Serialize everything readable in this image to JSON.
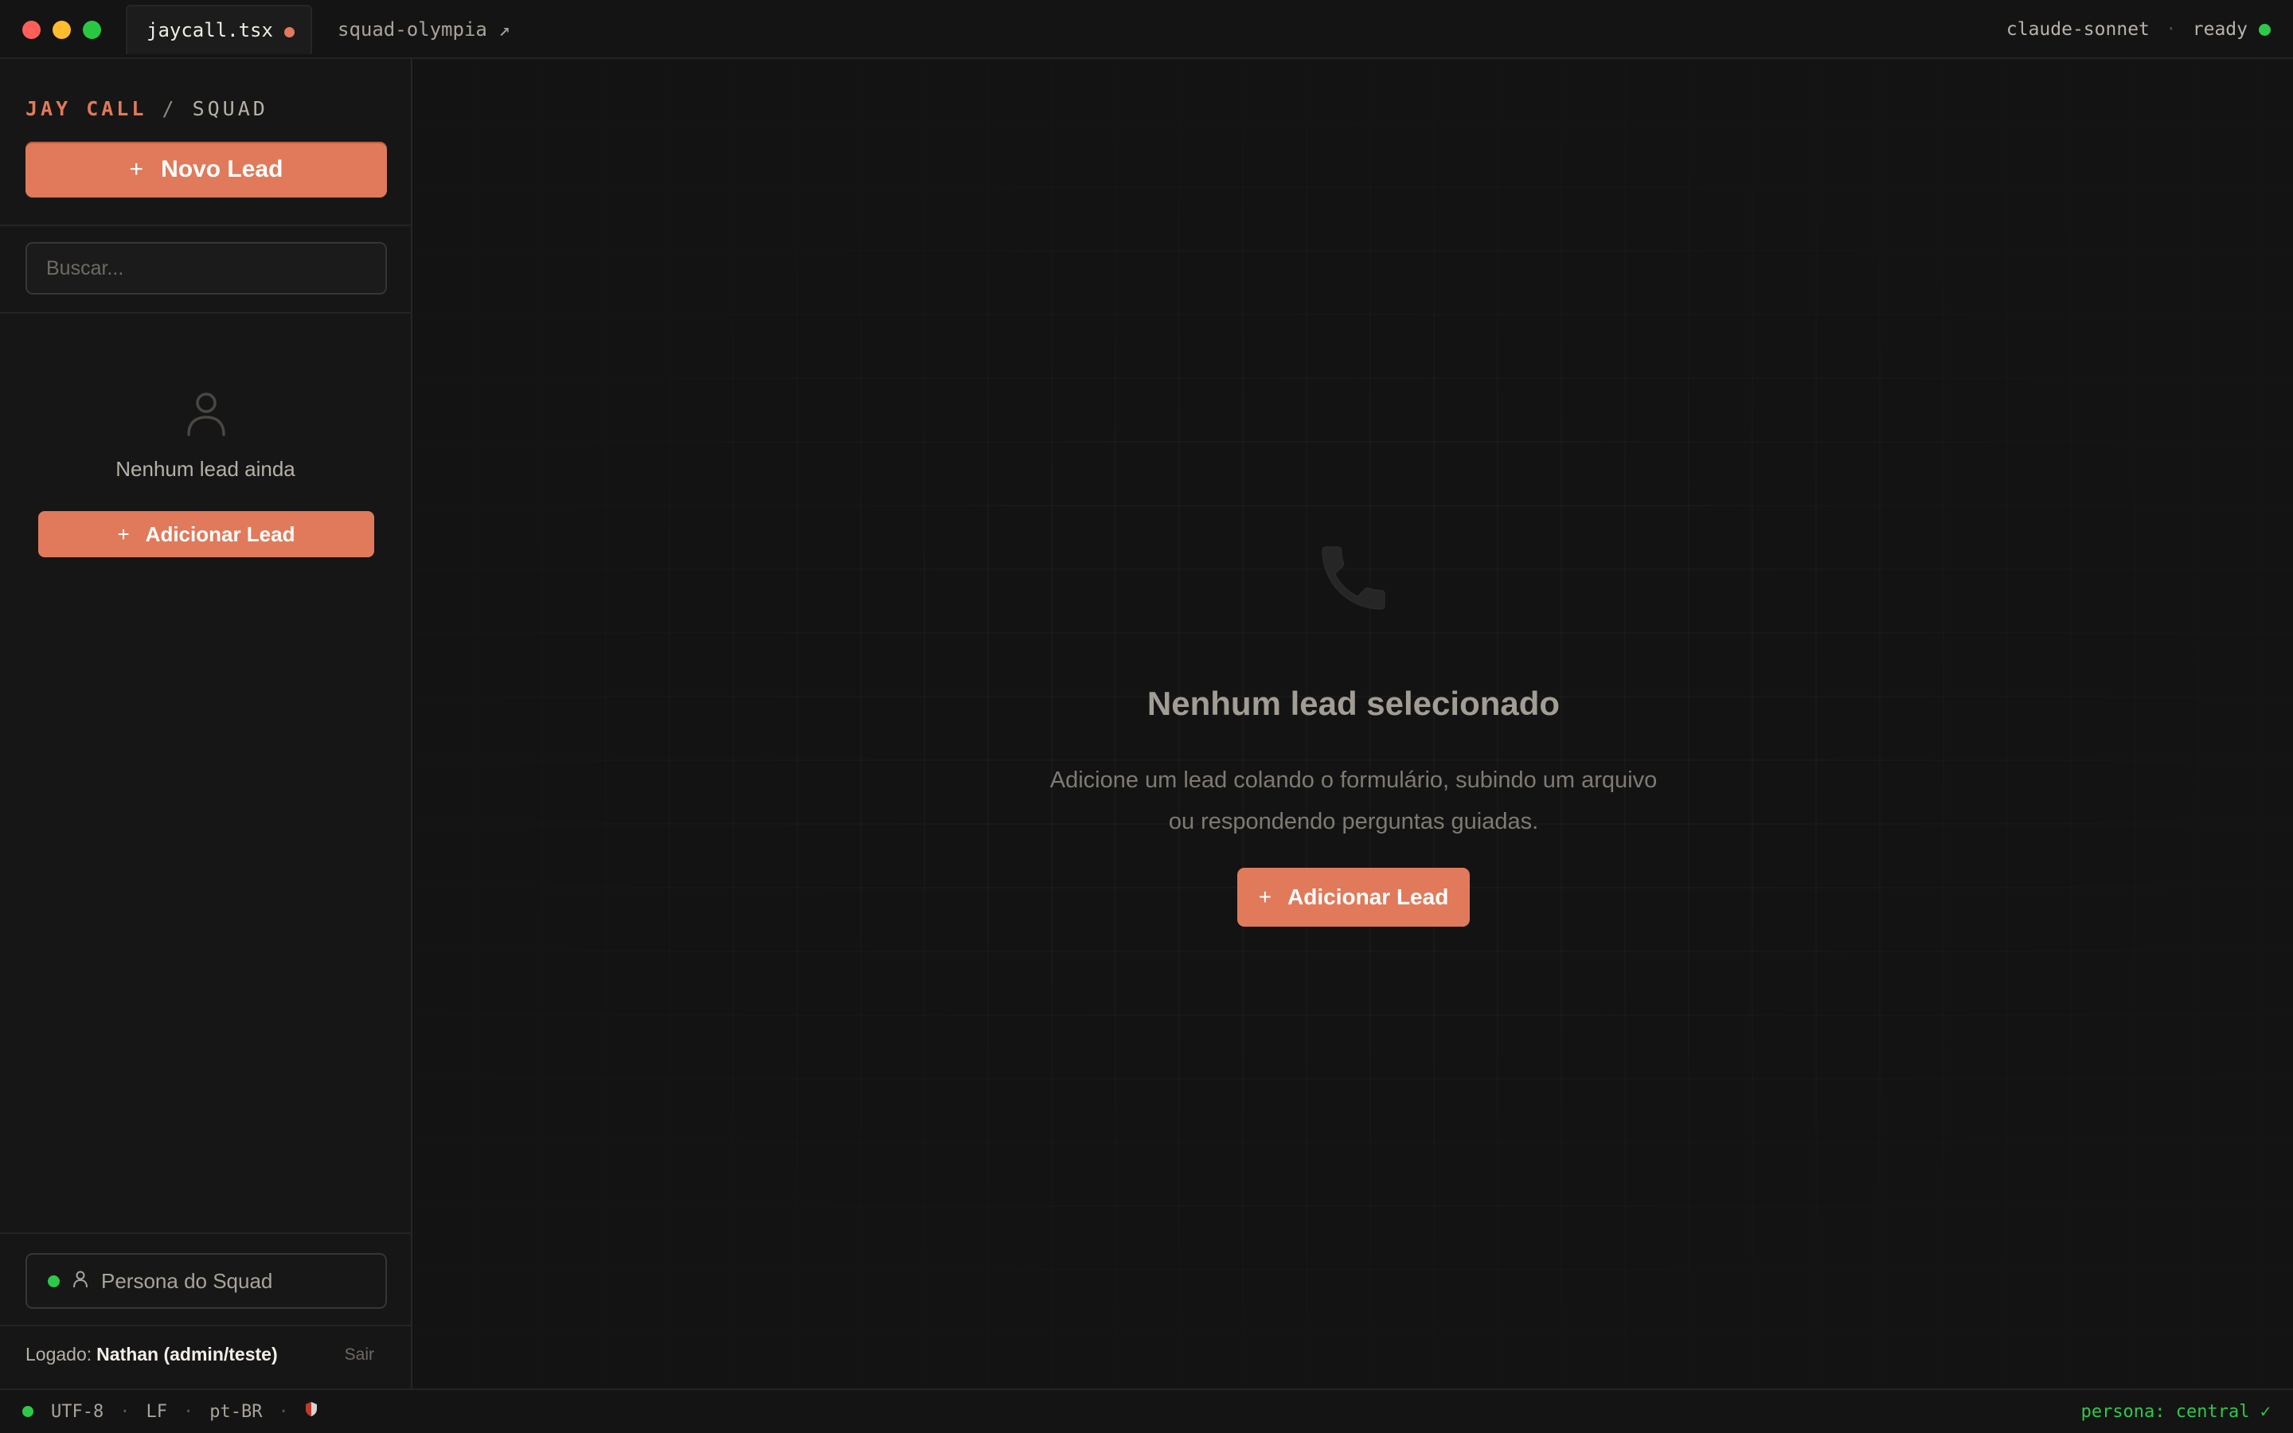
{
  "titlebar": {
    "tabs": [
      {
        "label": "jaycall.tsx",
        "modified": true
      },
      {
        "label": "squad-olympia ↗"
      }
    ],
    "model": "claude-sonnet",
    "separator": "·",
    "status": "ready"
  },
  "sidebar": {
    "brand": {
      "name": "JAY CALL",
      "slash": " / ",
      "section": "SQUAD"
    },
    "new_lead_button": {
      "icon": "+",
      "label": "Novo Lead"
    },
    "search": {
      "placeholder": "Buscar...",
      "value": ""
    },
    "empty_state": {
      "icon": "user-icon",
      "text": "Nenhum lead ainda"
    },
    "add_lead_button": {
      "icon": "+",
      "label": "Adicionar Lead"
    },
    "persona": {
      "label": "Persona do Squad",
      "status_color": "#2ec84a"
    },
    "logged": {
      "prefix": "Logado:",
      "user": "Nathan (admin/teste)",
      "logout": "Sair"
    }
  },
  "main": {
    "icon": "phone-icon",
    "title": "Nenhum lead selecionado",
    "description": "Adicione um lead colando o formulário, subindo um arquivo ou respondendo perguntas guiadas.",
    "add_lead_button": {
      "icon": "+",
      "label": "Adicionar Lead"
    }
  },
  "statusbar": {
    "items": [
      "UTF-8",
      "LF",
      "pt-BR"
    ],
    "separator": "·",
    "shield_icon": "shield-icon",
    "right": "persona: central ✓"
  },
  "colors": {
    "accent": "#e07a5a",
    "success": "#2ec84a",
    "background": "#131313"
  }
}
